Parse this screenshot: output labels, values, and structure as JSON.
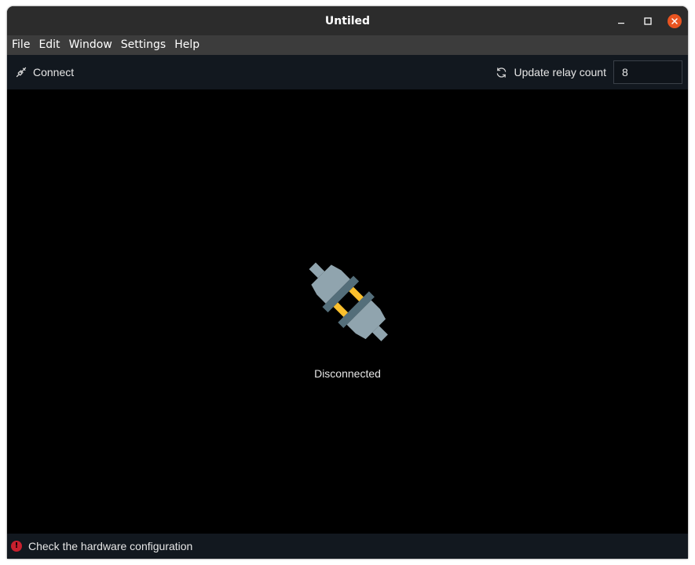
{
  "window": {
    "title": "Untiled"
  },
  "menu": {
    "items": [
      "File",
      "Edit",
      "Window",
      "Settings",
      "Help"
    ]
  },
  "toolbar": {
    "connect_label": "Connect",
    "connect_icon": "plug-connect-icon",
    "update_label": "Update relay count",
    "update_icon": "refresh-icon",
    "relay_count_value": "8"
  },
  "main": {
    "status_label": "Disconnected",
    "status_icon": "disconnected-plug-icon"
  },
  "statusbar": {
    "message": "Check the hardware configuration",
    "icon": "error-icon"
  },
  "colors": {
    "close_button": "#e95420",
    "error": "#c8202e",
    "plug_body": "#90a4ae",
    "plug_band": "#546e7a",
    "plug_prong": "#fbc02d"
  }
}
